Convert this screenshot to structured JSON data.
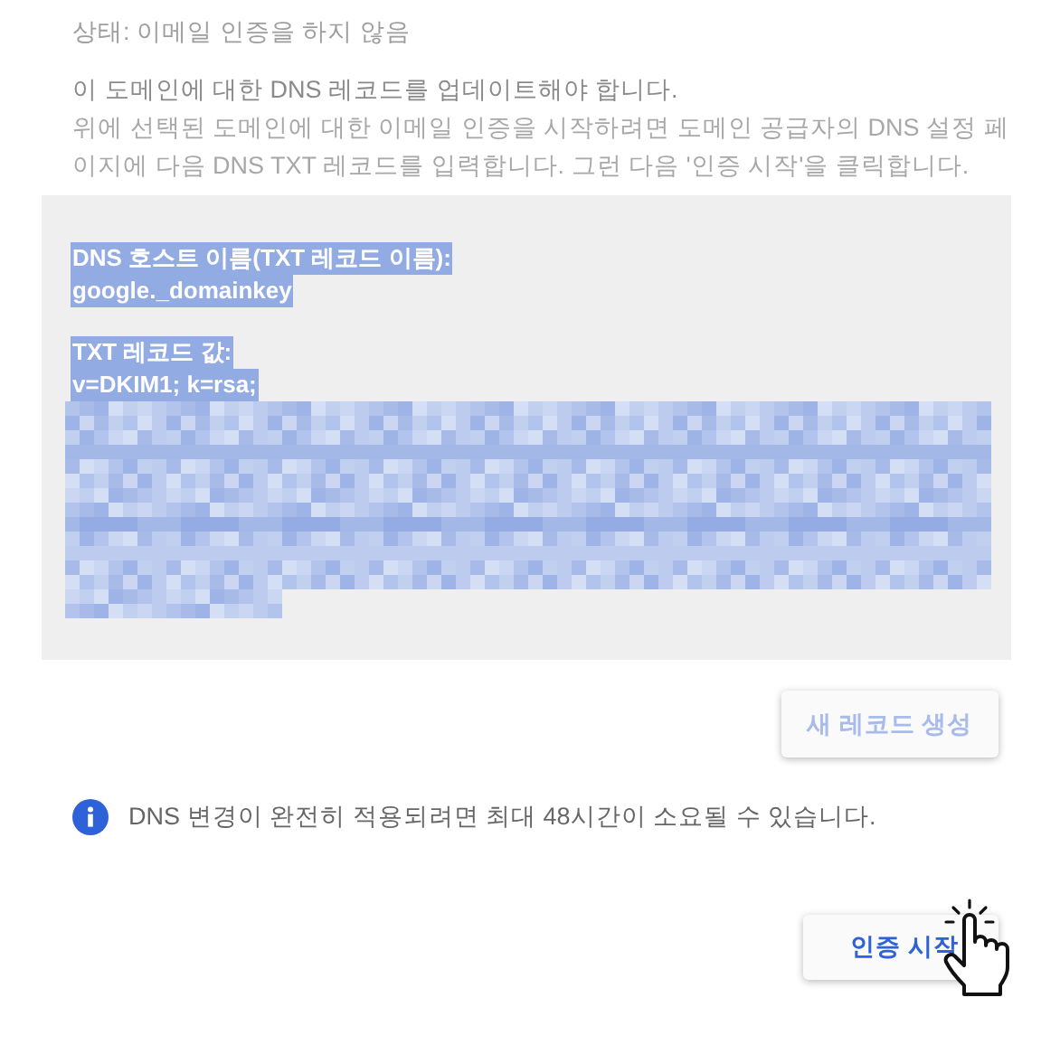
{
  "status": "상태: 이메일 인증을 하지 않음",
  "heading": "이 도메인에 대한 DNS 레코드를 업데이트해야 합니다.",
  "instructions": "위에 선택된 도메인에 대한 이메일 인증을 시작하려면 도메인 공급자의 DNS 설정 페이지에 다음 DNS TXT 레코드를 입력합니다. 그런 다음 '인증 시작'을 클릭합니다.",
  "record_box": {
    "host_label": "DNS 호스트 이름(TXT 레코드 이름):",
    "host_value": "google._domainkey",
    "txt_label": "TXT 레코드 값:",
    "txt_value": "v=DKIM1; k=rsa;"
  },
  "new_record_button": {
    "label": "새 레코드 생성",
    "disabled": true
  },
  "info_note": "DNS 변경이 완전히 적용되려면 최대 48시간이 소요될 수 있습니다.",
  "start_button": {
    "label": "인증 시작"
  }
}
